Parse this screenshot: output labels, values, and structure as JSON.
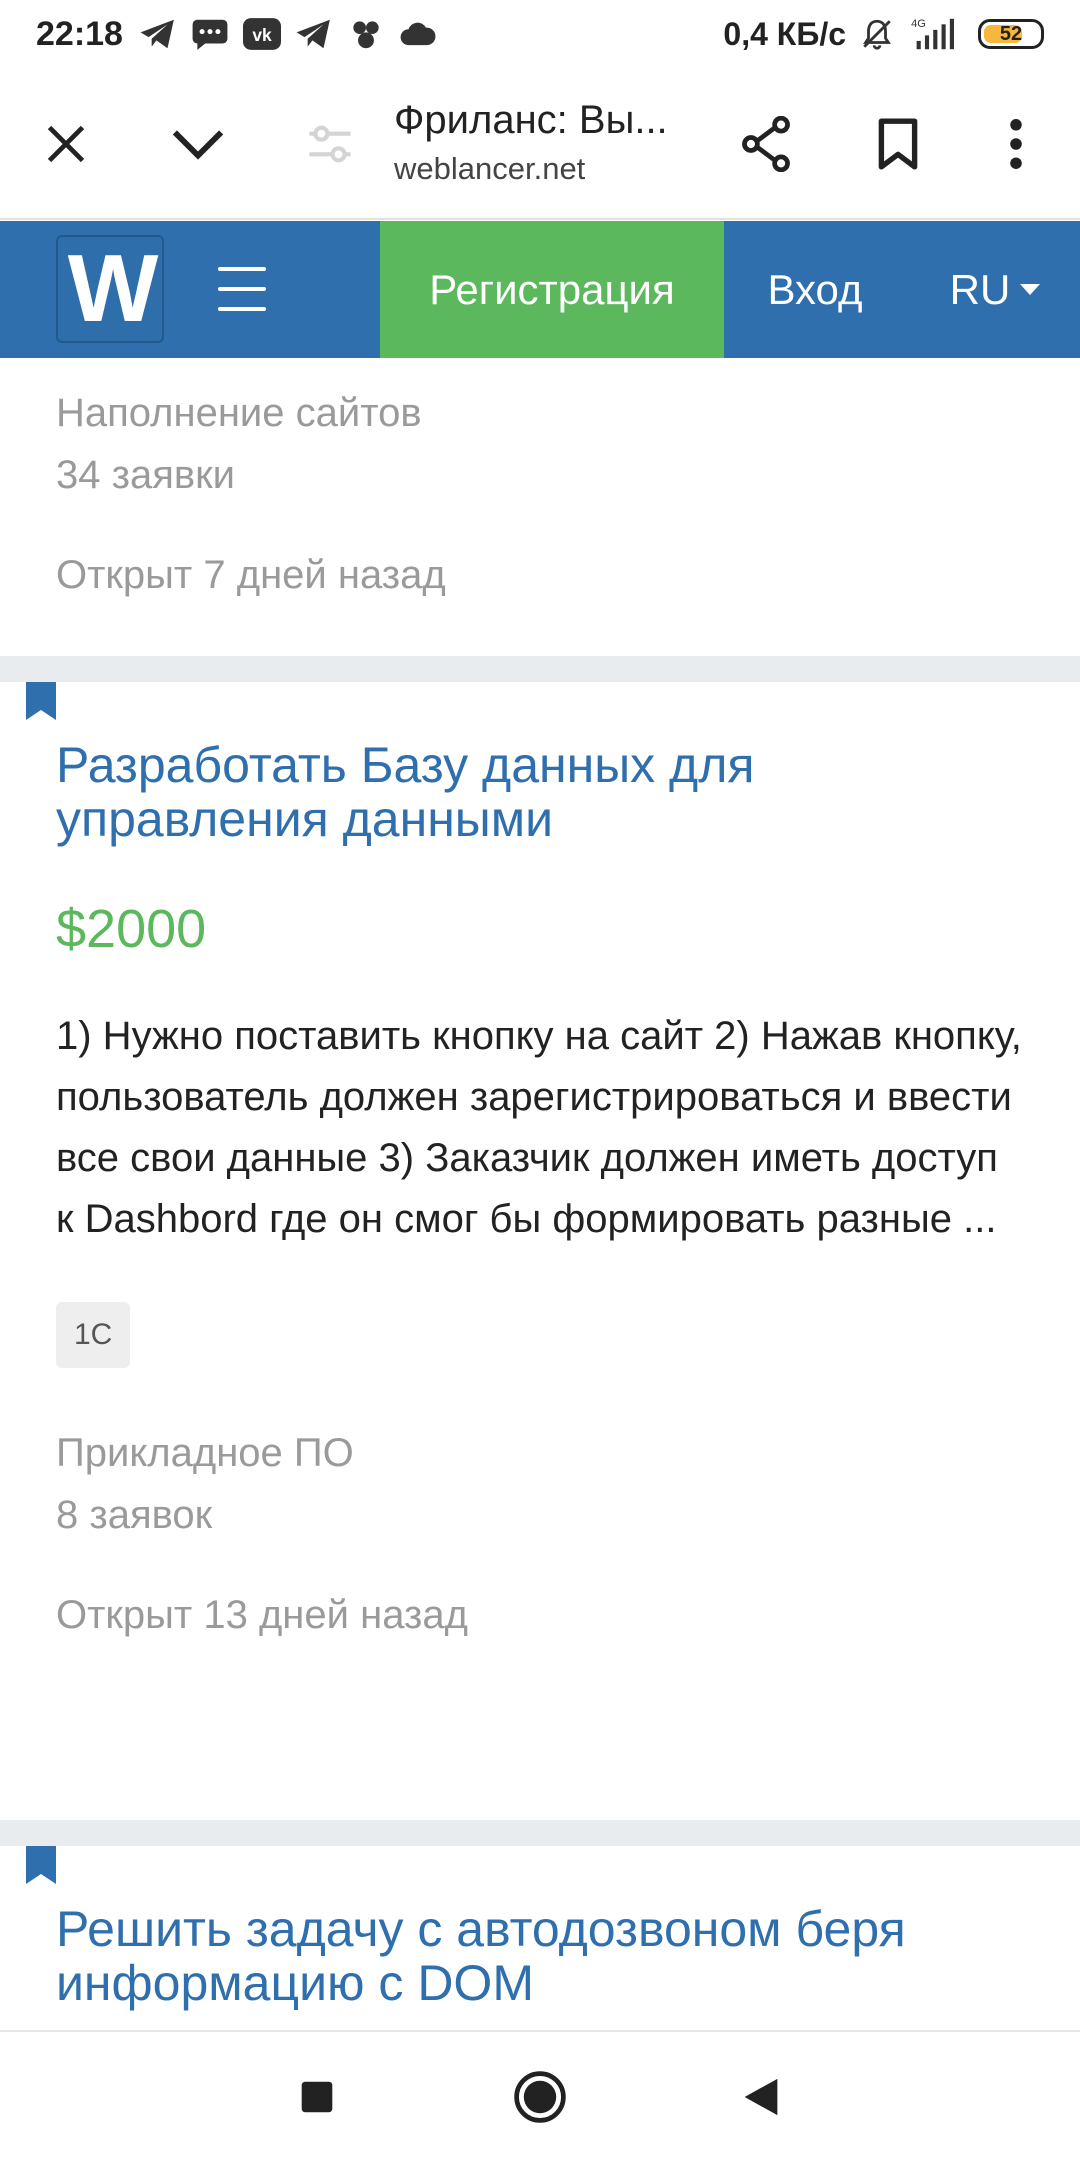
{
  "status_bar": {
    "time": "22:18",
    "network_speed": "0,4 КБ/с",
    "battery_level": "52",
    "icons_left": [
      "telegram-icon",
      "sms-icon",
      "vk-icon",
      "telegram-icon",
      "app-icon",
      "cloud-icon"
    ],
    "icons_right": [
      "mute-bell-icon",
      "signal-4g-icon",
      "battery-icon"
    ]
  },
  "toolbar": {
    "page_title": "Фриланс: Вы...",
    "url": "weblancer.net",
    "icons": [
      "close-icon",
      "chevron-down-icon",
      "tune-icon",
      "share-icon",
      "bookmark-icon",
      "more-vert-icon"
    ]
  },
  "site_nav": {
    "logo_text": "W",
    "register_label": "Регистрация",
    "login_label": "Вход",
    "language_label": "RU"
  },
  "colors": {
    "brand_blue": "#2f6fad",
    "register_green": "#5cb85c",
    "price_green": "#5cb85c",
    "muted_text": "#9a9a9a"
  },
  "listing_partial": {
    "category": "Наполнение сайтов",
    "bids": "34 заявки",
    "opened": "Открыт 7 дней назад"
  },
  "listing_main": {
    "title": "Разработать Базу данных для управления данными",
    "price": "$2000",
    "description": "1) Нужно поставить кнопку на сайт 2) Нажав кнопку, пользователь должен зарегистрироваться и ввести все свои данные 3) Заказчик должен иметь доступ к Dashbord где он смог бы формировать разные ...",
    "tag": "1C",
    "category": "Прикладное ПО",
    "bids": "8 заявок",
    "opened": "Открыт 13 дней назад"
  },
  "listing_next": {
    "title": "Решить задачу с автодозвоном беря информацию с DOM"
  },
  "nav_bar": {
    "icons": [
      "recents-square-icon",
      "home-circle-icon",
      "back-triangle-icon"
    ]
  }
}
